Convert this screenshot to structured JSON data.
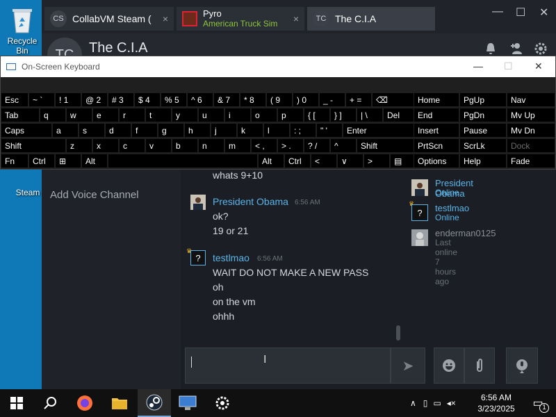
{
  "desktop": {
    "recycle_bin_label": "Recycle Bin",
    "steam_label": "Steam"
  },
  "tabs": [
    {
      "initials": "CS",
      "label": "CollabVM Steam (",
      "close": "×"
    },
    {
      "label": "Pyro",
      "sub": "American Truck Sim",
      "close": "×"
    },
    {
      "initials": "TC",
      "label": "The C.I.A"
    }
  ],
  "window_controls": {
    "minimize": "—",
    "maximize": "☐",
    "close": "✕"
  },
  "chat_header": {
    "initials": "TC",
    "title": "The C.I.A"
  },
  "osk": {
    "title": "On-Screen Keyboard",
    "row1": [
      {
        "label": "Esc"
      },
      {
        "label": "~ `"
      },
      {
        "label": "! 1"
      },
      {
        "label": "@ 2"
      },
      {
        "label": "# 3"
      },
      {
        "label": "$ 4"
      },
      {
        "label": "% 5"
      },
      {
        "label": "^ 6"
      },
      {
        "label": "& 7"
      },
      {
        "label": "* 8"
      },
      {
        "label": "( 9"
      },
      {
        "label": ") 0"
      },
      {
        "label": "_ -"
      },
      {
        "label": "+ ="
      },
      {
        "label": "⌫"
      }
    ],
    "row2": [
      "Tab",
      "q",
      "w",
      "e",
      "r",
      "t",
      "y",
      "u",
      "i",
      "o",
      "p",
      "{ [",
      "} ]",
      "| \\",
      "Del"
    ],
    "row3": [
      "Caps",
      "a",
      "s",
      "d",
      "f",
      "g",
      "h",
      "j",
      "k",
      "l",
      ": ;",
      "\" '",
      "Enter"
    ],
    "row4": [
      "Shift",
      "z",
      "x",
      "c",
      "v",
      "b",
      "n",
      "m",
      "< ,",
      "> .",
      "? /",
      "^",
      "Shift"
    ],
    "row5": [
      "Fn",
      "Ctrl",
      "⊞",
      "Alt",
      "",
      "Alt",
      "Ctrl",
      "<",
      "∨",
      ">",
      "▤"
    ],
    "nav": [
      [
        "Home",
        "PgUp",
        "Nav"
      ],
      [
        "End",
        "PgDn",
        "Mv Up"
      ],
      [
        "Insert",
        "Pause",
        "Mv Dn"
      ],
      [
        "PrtScn",
        "ScrLk",
        "Dock"
      ],
      [
        "Options",
        "Help",
        "Fade"
      ]
    ]
  },
  "left_panel": {
    "voice_channel": "Add Voice Channel"
  },
  "messages": {
    "top_text": "whats 9+10",
    "obama_name": "President Obama",
    "obama_time": "6:56 AM",
    "obama_lines": [
      "ok?",
      "19 or 21"
    ],
    "testlmao_name": "testlmao",
    "testlmao_time": "6:56 AM",
    "testlmao_lines": [
      "WAIT DO NOT MAKE A NEW PASS",
      "oh",
      "on the vm",
      "ohhh"
    ]
  },
  "members": [
    {
      "name": "President Obama",
      "status": "Online",
      "color": "#5ab4e8"
    },
    {
      "name": "testlmao",
      "status": "Online",
      "color": "#5ab4e8"
    },
    {
      "name": "enderman0125",
      "status": "Last online 7 hours ago",
      "color": "#8a8f96"
    }
  ],
  "taskbar": {
    "time": "6:56 AM",
    "date": "3/23/2025",
    "notification_count": "1"
  },
  "colors": {
    "online": "#5ab4e8",
    "accent": "#1a9fff",
    "desktop": "#0f79b8"
  }
}
